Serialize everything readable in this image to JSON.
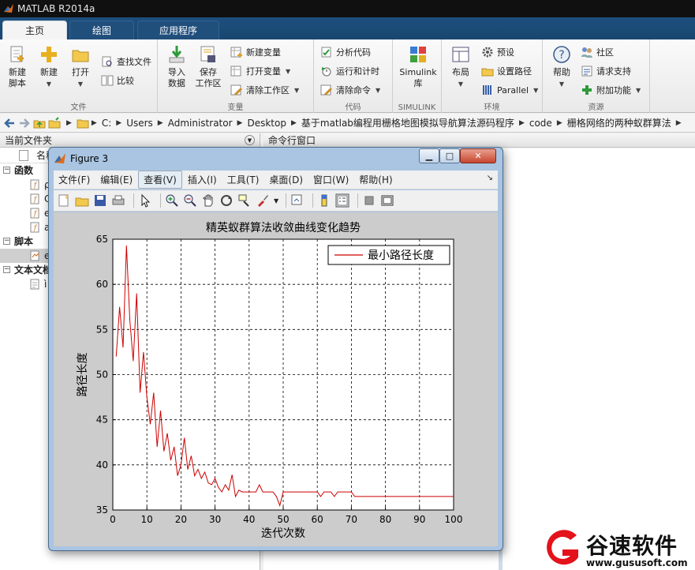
{
  "app": {
    "title": "MATLAB R2014a"
  },
  "tabs": [
    {
      "label": "主页",
      "active": true
    },
    {
      "label": "绘图",
      "active": false
    },
    {
      "label": "应用程序",
      "active": false
    }
  ],
  "ribbon": {
    "file": {
      "label": "文件",
      "new_script": "新建\n脚本",
      "new": "新建",
      "open": "打开",
      "find_files": "查找文件",
      "compare": "比较"
    },
    "variable": {
      "label": "变量",
      "import": "导入\n数据",
      "save_ws": "保存\n工作区",
      "new_var": "新建变量",
      "open_var": "打开变量",
      "clear_ws": "清除工作区"
    },
    "code": {
      "label": "代码",
      "analyze": "分析代码",
      "run_time": "运行和计时",
      "clear_cmd": "清除命令"
    },
    "simulink": {
      "label": "SIMULINK",
      "lib": "Simulink\n库"
    },
    "env": {
      "label": "环境",
      "layout": "布局",
      "prefs": "预设",
      "set_path": "设置路径",
      "parallel": "Parallel"
    },
    "resources": {
      "label": "资源",
      "help": "帮助",
      "community": "社区",
      "request_support": "请求支持",
      "addons": "附加功能"
    }
  },
  "address": {
    "crumbs": [
      "C:",
      "Users",
      "Administrator",
      "Desktop",
      "基于matlab编程用栅格地图模拟导航算法源码程序",
      "code",
      "栅格网络的两种蚁群算法"
    ]
  },
  "left_panel": {
    "title": "当前文件夹",
    "col_name": "名称",
    "sections": [
      {
        "name": "函数",
        "items": [
          "ρ",
          "C",
          "e",
          "a"
        ]
      },
      {
        "name": "脚本",
        "items": [
          "e"
        ]
      },
      {
        "name": "文本文档",
        "items": [
          "ì"
        ]
      }
    ]
  },
  "command_window": {
    "title": "命令行窗口"
  },
  "figure": {
    "title": "Figure 3",
    "menu": [
      "文件(F)",
      "编辑(E)",
      "查看(V)",
      "插入(I)",
      "工具(T)",
      "桌面(D)",
      "窗口(W)",
      "帮助(H)"
    ],
    "selected_menu": "查看(V)",
    "toolbar_icons": [
      "new-figure-icon",
      "open-file-icon",
      "save-icon",
      "print-icon",
      "pointer-icon",
      "zoom-in-icon",
      "zoom-out-icon",
      "pan-hand-icon",
      "rotate-icon",
      "data-cursor-icon",
      "brush-icon",
      "link-plot-icon",
      "colorbar-icon",
      "legend-icon",
      "hide-tools-icon",
      "show-tools-icon"
    ]
  },
  "chart_data": {
    "type": "line",
    "title": "精英蚁群算法收敛曲线变化趋势",
    "xlabel": "迭代次数",
    "ylabel": "路径长度",
    "xlim": [
      0,
      100
    ],
    "ylim": [
      35,
      65
    ],
    "xticks": [
      0,
      10,
      20,
      30,
      40,
      50,
      60,
      70,
      80,
      90,
      100
    ],
    "yticks": [
      35,
      40,
      45,
      50,
      55,
      60,
      65
    ],
    "grid": true,
    "legend_position": "top-right",
    "color": "#cc0000",
    "series": [
      {
        "name": "最小路径长度",
        "x": [
          1,
          2,
          3,
          4,
          5,
          6,
          7,
          8,
          9,
          10,
          11,
          12,
          13,
          14,
          15,
          16,
          17,
          18,
          19,
          20,
          21,
          22,
          23,
          24,
          25,
          26,
          27,
          28,
          29,
          30,
          31,
          32,
          33,
          34,
          35,
          36,
          37,
          38,
          39,
          40,
          41,
          42,
          43,
          44,
          45,
          46,
          47,
          48,
          49,
          50,
          51,
          52,
          53,
          54,
          55,
          56,
          57,
          58,
          59,
          60,
          61,
          62,
          63,
          64,
          65,
          66,
          67,
          68,
          69,
          70,
          71,
          72,
          73,
          74,
          75,
          76,
          77,
          78,
          79,
          80,
          81,
          82,
          83,
          84,
          85,
          86,
          87,
          88,
          89,
          90,
          91,
          92,
          93,
          94,
          95,
          96,
          97,
          98,
          99,
          100
        ],
        "values": [
          52.0,
          57.5,
          53.0,
          64.3,
          56.0,
          51.5,
          59.0,
          48.0,
          52.5,
          47.5,
          44.5,
          48.0,
          42.0,
          46.0,
          41.5,
          43.5,
          40.5,
          42.0,
          38.8,
          40.0,
          43.0,
          39.5,
          41.0,
          38.8,
          39.5,
          38.5,
          39.2,
          38.0,
          37.8,
          38.5,
          37.5,
          37.0,
          37.8,
          37.2,
          38.9,
          36.5,
          37.2,
          37.0,
          37.0,
          37.0,
          37.0,
          37.0,
          37.8,
          37.0,
          37.0,
          37.0,
          37.0,
          36.5,
          35.5,
          37.0,
          37.0,
          37.0,
          37.0,
          37.0,
          37.0,
          37.0,
          37.0,
          37.0,
          37.0,
          37.0,
          36.5,
          37.0,
          37.0,
          37.0,
          36.5,
          37.0,
          37.0,
          37.0,
          37.0,
          37.0,
          36.5,
          36.5,
          36.5,
          36.5,
          36.5,
          36.5,
          36.5,
          36.5,
          36.5,
          36.5,
          36.5,
          36.5,
          36.5,
          36.5,
          36.5,
          36.5,
          36.5,
          36.5,
          36.5,
          36.5,
          36.5,
          36.5,
          36.5,
          36.5,
          36.5,
          36.5,
          36.5,
          36.5,
          36.5,
          36.5
        ]
      }
    ]
  },
  "watermark": {
    "text": "谷速软件",
    "url": "www.gususoft.com"
  }
}
